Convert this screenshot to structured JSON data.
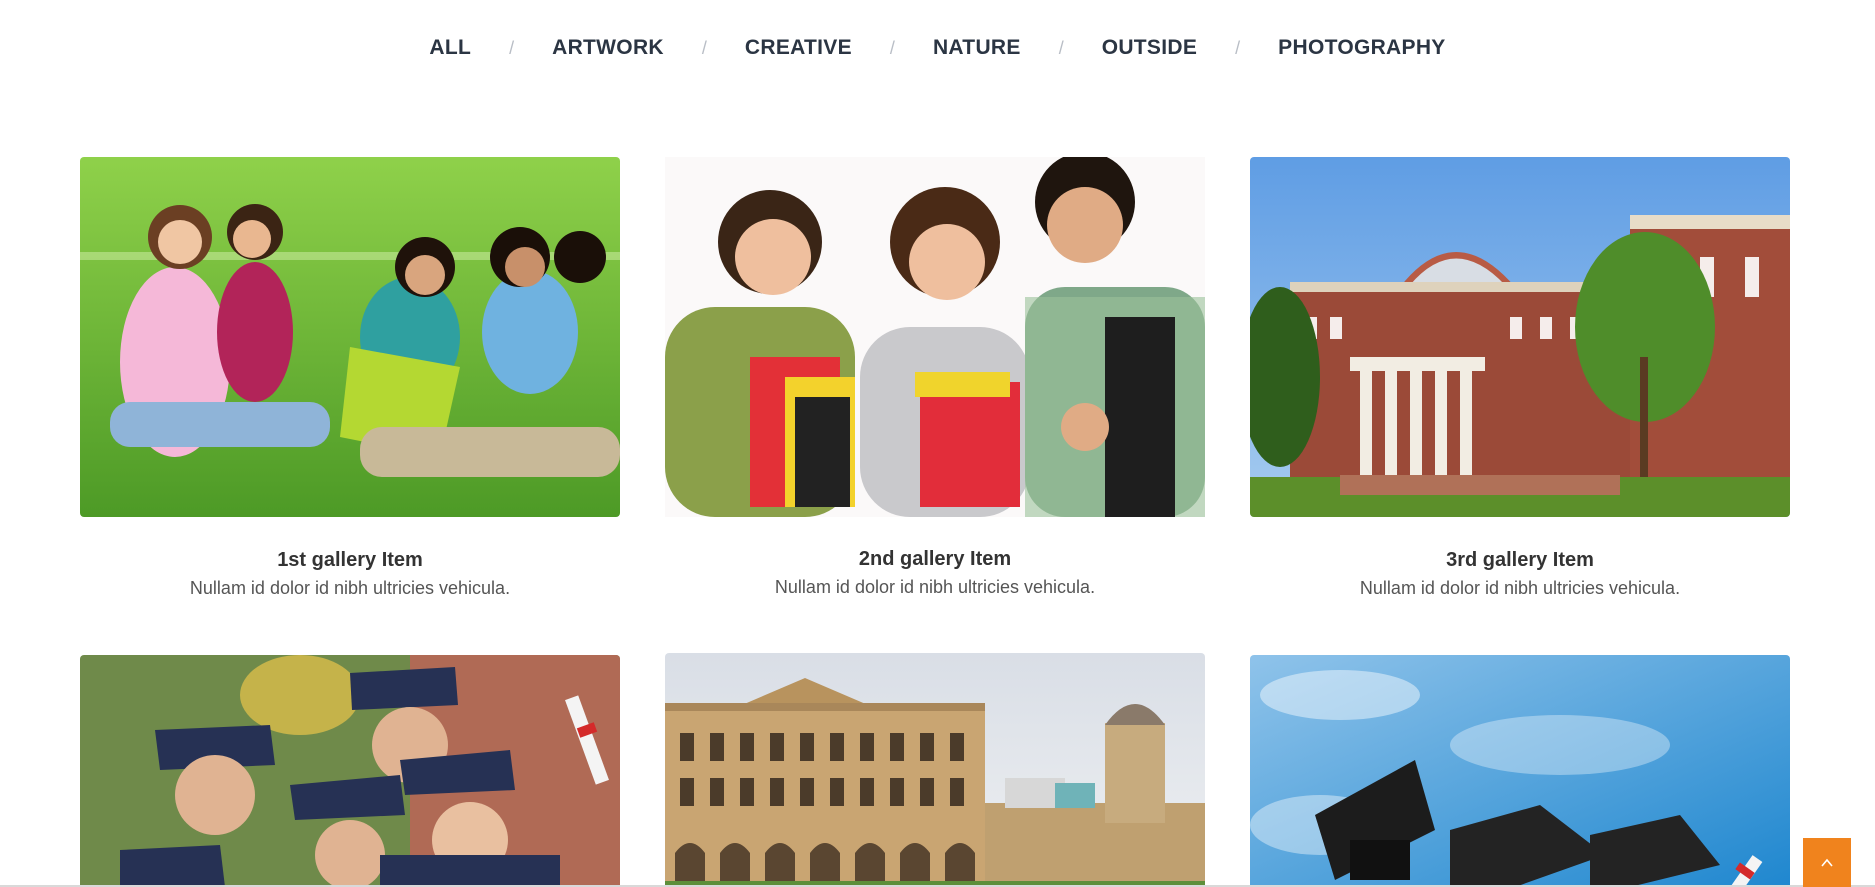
{
  "filters": [
    {
      "label": "ALL"
    },
    {
      "label": "ARTWORK"
    },
    {
      "label": "CREATIVE"
    },
    {
      "label": "NATURE"
    },
    {
      "label": "OUTSIDE"
    },
    {
      "label": "PHOTOGRAPHY"
    }
  ],
  "filter_separator": "/",
  "gallery": {
    "items": [
      {
        "title": "1st gallery Item",
        "description": "Nullam id dolor id nibh ultricies vehicula."
      },
      {
        "title": "2nd gallery Item",
        "description": "Nullam id dolor id nibh ultricies vehicula."
      },
      {
        "title": "3rd gallery Item",
        "description": "Nullam id dolor id nibh ultricies vehicula."
      }
    ]
  },
  "back_to_top": {
    "icon": "chevron-up-icon",
    "color": "#f0831d"
  },
  "colors": {
    "nav_text": "#2b3543",
    "accent": "#f0831d"
  }
}
